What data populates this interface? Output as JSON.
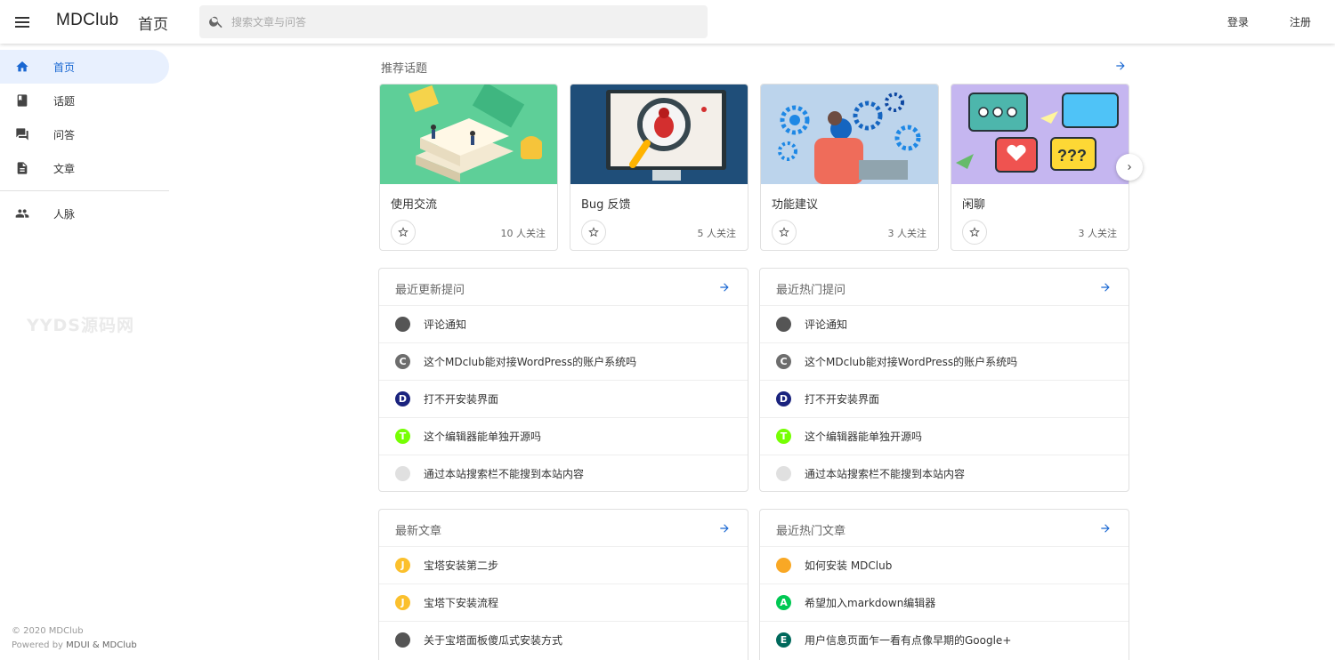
{
  "header": {
    "logo": "MDClub",
    "title": "首页",
    "search_placeholder": "搜索文章与问答",
    "login": "登录",
    "register": "注册"
  },
  "sidebar": {
    "items": [
      {
        "label": "首页",
        "icon": "home-icon"
      },
      {
        "label": "话题",
        "icon": "book-icon"
      },
      {
        "label": "问答",
        "icon": "forum-icon"
      },
      {
        "label": "文章",
        "icon": "article-icon"
      },
      {
        "label": "人脉",
        "icon": "people-icon"
      }
    ],
    "watermark": "YYDS源码网",
    "copyright": "© 2020 MDClub",
    "powered_prefix": "Powered by ",
    "powered_links": "MDUI & MDClub"
  },
  "topics": {
    "title": "推荐话题",
    "items": [
      {
        "name": "使用交流",
        "followers": "10 人关注"
      },
      {
        "name": "Bug 反馈",
        "followers": "5 人关注"
      },
      {
        "name": "功能建议",
        "followers": "3 人关注"
      },
      {
        "name": "闲聊",
        "followers": "3 人关注"
      }
    ]
  },
  "recent_questions": {
    "title": "最近更新提问",
    "items": [
      {
        "text": "评论通知",
        "avatar": "",
        "color": "#555555"
      },
      {
        "text": "这个MDclub能对接WordPress的账户系统吗",
        "avatar": "C",
        "color": "#6d6d6d"
      },
      {
        "text": "打不开安装界面",
        "avatar": "D",
        "color": "#1a237e"
      },
      {
        "text": "这个编辑器能单独开源吗",
        "avatar": "T",
        "color": "#76ff03"
      },
      {
        "text": "通过本站搜索栏不能搜到本站内容",
        "avatar": "",
        "color": "#e0e0e0"
      }
    ]
  },
  "hot_questions": {
    "title": "最近热门提问",
    "items": [
      {
        "text": "评论通知",
        "avatar": "",
        "color": "#555555"
      },
      {
        "text": "这个MDclub能对接WordPress的账户系统吗",
        "avatar": "C",
        "color": "#6d6d6d"
      },
      {
        "text": "打不开安装界面",
        "avatar": "D",
        "color": "#1a237e"
      },
      {
        "text": "这个编辑器能单独开源吗",
        "avatar": "T",
        "color": "#76ff03"
      },
      {
        "text": "通过本站搜索栏不能搜到本站内容",
        "avatar": "",
        "color": "#e0e0e0"
      }
    ]
  },
  "latest_articles": {
    "title": "最新文章",
    "items": [
      {
        "text": "宝塔安装第二步",
        "avatar": "J",
        "color": "#fbc02d"
      },
      {
        "text": "宝塔下安装流程",
        "avatar": "J",
        "color": "#fbc02d"
      },
      {
        "text": "关于宝塔面板傻瓜式安装方式",
        "avatar": "",
        "color": "#555555"
      }
    ]
  },
  "hot_articles": {
    "title": "最近热门文章",
    "items": [
      {
        "text": "如何安装 MDClub",
        "avatar": "",
        "color": "#f9a825"
      },
      {
        "text": "希望加入markdown编辑器",
        "avatar": "A",
        "color": "#00c853"
      },
      {
        "text": "用户信息页面乍一看有点像早期的Google+",
        "avatar": "E",
        "color": "#00695c"
      }
    ]
  },
  "colors": {
    "accent": "#1967d2",
    "active_bg": "#e8f0fe"
  }
}
